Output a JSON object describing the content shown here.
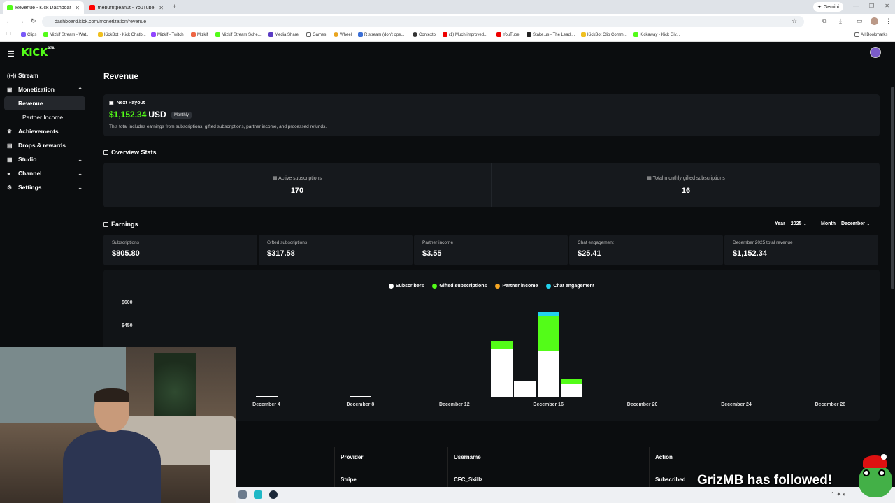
{
  "browser": {
    "tabs": [
      {
        "label": "Revenue - Kick Dashboard",
        "active": true,
        "color": "#53fc18"
      },
      {
        "label": "theburntpeanut - YouTube",
        "active": false,
        "color": "#ff0000"
      }
    ],
    "gemini_label": "Gemini",
    "url": "dashboard.kick.com/monetization/revenue",
    "bookmarks": [
      "Clips",
      "Mizkif Stream - Wat...",
      "KickBot - Kick Chatb...",
      "Mizkif - Twitch",
      "Mizkif",
      "Mizkif Stream Sche...",
      "Media Share",
      "Games",
      "Wheel",
      "R.stream (don't ope...",
      "Contexto",
      "(1) Much improved...",
      "YouTube",
      "Stake.us - The Leadi...",
      "KickBot Clip Comm...",
      "Kickaway - Kick Giv..."
    ],
    "all_bookmarks": "All Bookmarks"
  },
  "app": {
    "logo": "KICK",
    "logo_sup": "BETA",
    "sidebar": {
      "items": [
        {
          "label": "Stream",
          "icon": "broadcast-icon"
        },
        {
          "label": "Monetization",
          "icon": "dollar-icon",
          "chevron": "up"
        },
        {
          "label": "Achievements",
          "icon": "trophy-icon"
        },
        {
          "label": "Drops & rewards",
          "icon": "gift-icon"
        },
        {
          "label": "Studio",
          "icon": "film-icon",
          "chevron": "down"
        },
        {
          "label": "Channel",
          "icon": "user-icon",
          "chevron": "down"
        },
        {
          "label": "Settings",
          "icon": "gear-icon",
          "chevron": "down"
        }
      ],
      "sub_items": [
        "Revenue",
        "Partner Income"
      ]
    },
    "page_title": "Revenue",
    "payout": {
      "label": "Next Payout",
      "amount": "$1,152.34",
      "currency": "USD",
      "badge": "Monthly",
      "description": "This total includes earnings from subscriptions, gifted subscriptions, partner income, and processed refunds."
    },
    "overview": {
      "title": "Overview Stats",
      "active_label": "Active subscriptions",
      "active_value": "170",
      "gifted_label": "Total monthly gifted subscriptions",
      "gifted_value": "16"
    },
    "earnings": {
      "title": "Earnings",
      "year_label": "Year",
      "year_value": "2025",
      "month_label": "Month",
      "month_value": "December",
      "cards": [
        {
          "label": "Subscriptions",
          "value": "$805.80"
        },
        {
          "label": "Gifted subscriptions",
          "value": "$317.58"
        },
        {
          "label": "Partner income",
          "value": "$3.55"
        },
        {
          "label": "Chat engagement",
          "value": "$25.41"
        },
        {
          "label": "December 2025 total revenue",
          "value": "$1,152.34"
        }
      ]
    },
    "table": {
      "headers": [
        "Provider",
        "Username",
        "Action"
      ],
      "row": [
        "Stripe",
        "CFC_Skillz",
        "Subscribed"
      ]
    }
  },
  "chart_data": {
    "type": "bar",
    "stacked": true,
    "legend": [
      "Subscribers",
      "Gifted subscriptions",
      "Partner income",
      "Chat engagement"
    ],
    "colors": {
      "Subscribers": "#ffffff",
      "Gifted subscriptions": "#53fc18",
      "Partner income": "#f5a623",
      "Chat engagement": "#22d3ee"
    },
    "y_ticks": [
      "$600",
      "$450"
    ],
    "x_ticks": [
      "December 4",
      "December 8",
      "December 12",
      "December 16",
      "December 20",
      "December 24",
      "December 28"
    ],
    "ylim": [
      0,
      600
    ],
    "days": [
      {
        "day": 4,
        "Subscribers": 2,
        "Gifted subscriptions": 0,
        "Partner income": 0,
        "Chat engagement": 0
      },
      {
        "day": 8,
        "Subscribers": 2,
        "Gifted subscriptions": 0,
        "Partner income": 0,
        "Chat engagement": 0
      },
      {
        "day": 14,
        "Subscribers": 310,
        "Gifted subscriptions": 55,
        "Partner income": 0,
        "Chat engagement": 0
      },
      {
        "day": 15,
        "Subscribers": 100,
        "Gifted subscriptions": 0,
        "Partner income": 0,
        "Chat engagement": 0
      },
      {
        "day": 16,
        "Subscribers": 300,
        "Gifted subscriptions": 225,
        "Partner income": 0,
        "Chat engagement": 25
      },
      {
        "day": 17,
        "Subscribers": 80,
        "Gifted subscriptions": 35,
        "Partner income": 0,
        "Chat engagement": 0
      }
    ]
  },
  "overlay": {
    "alert_text": "GrizMB has followed!"
  }
}
